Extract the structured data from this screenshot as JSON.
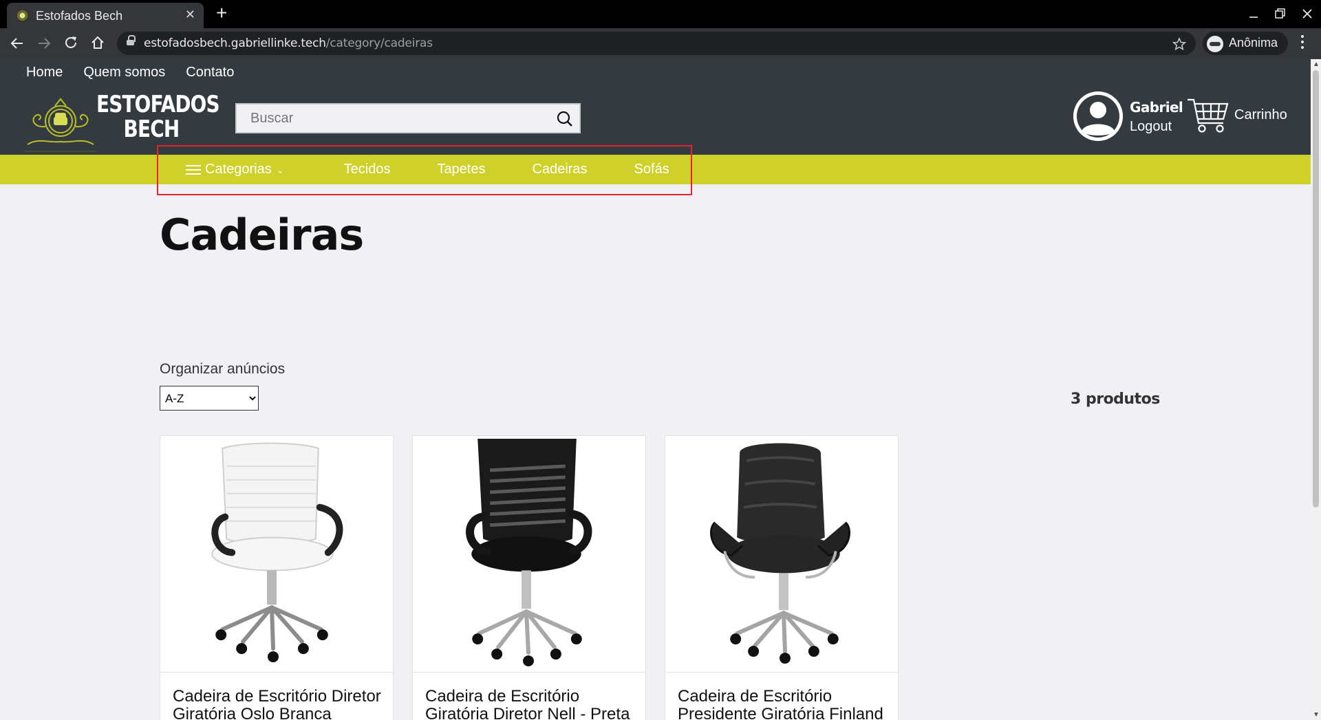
{
  "browser": {
    "tab_title": "Estofados Bech",
    "tab_close": "✕",
    "new_tab": "+",
    "url_host": "estofadosbech.gabriellinke.tech",
    "url_path": "/category/cadeiras",
    "profile_label": "Anônima"
  },
  "site": {
    "topnav": [
      "Home",
      "Quem somos",
      "Contato"
    ],
    "logo_line1": "ESTOFADOS",
    "logo_line2": "BECH",
    "search_placeholder": "Buscar",
    "user_name": "Gabriel",
    "logout_label": "Logout",
    "cart_label": "Carrinho",
    "categories_label": "Categorias",
    "categories": [
      "Tecidos",
      "Tapetes",
      "Cadeiras",
      "Sofás"
    ],
    "colors": {
      "header": "#343b40",
      "category_bar": "#cfd02a",
      "highlight": "#e3252b"
    }
  },
  "page": {
    "title": "Cadeiras",
    "sort_label": "Organizar anúncios",
    "sort_value": "A-Z",
    "product_count": "3 produtos",
    "products": [
      {
        "name": "Cadeira de Escritório Diretor Giratória Oslo Branca",
        "chair": "white"
      },
      {
        "name": "Cadeira de Escritório Giratória Diretor Nell - Preta",
        "chair": "mesh"
      },
      {
        "name": "Cadeira de Escritório Presidente Giratória Finland",
        "chair": "leather"
      }
    ]
  }
}
